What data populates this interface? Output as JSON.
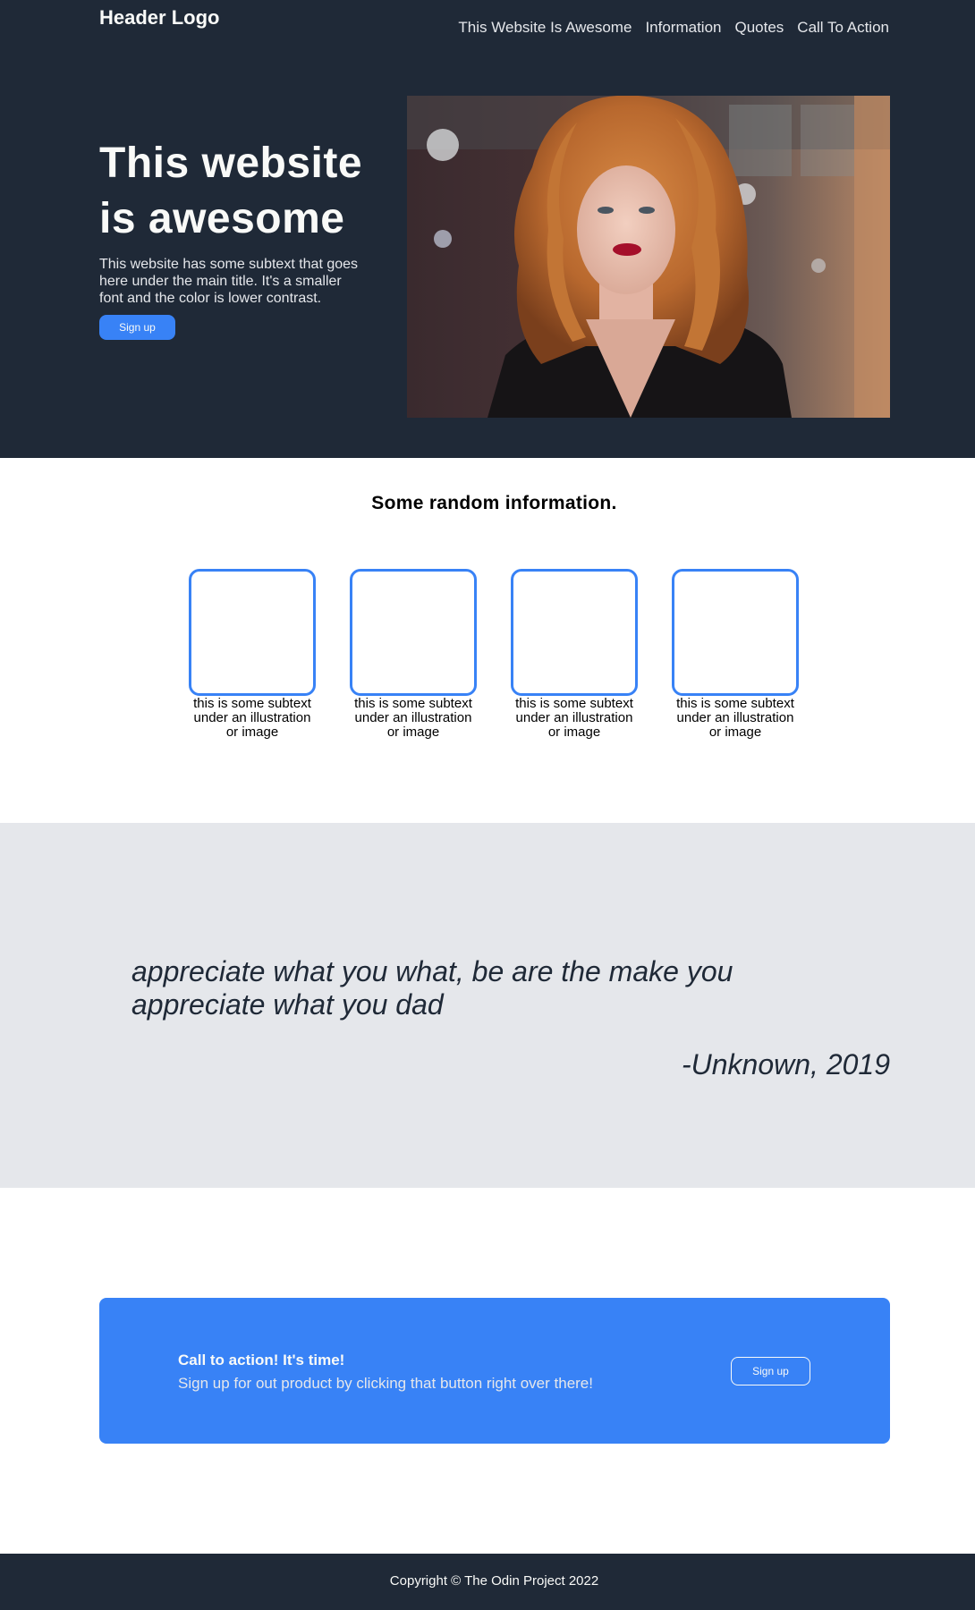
{
  "header": {
    "logo": "Header Logo",
    "nav": [
      "This Website Is Awesome",
      "Information",
      "Quotes",
      "Call To Action"
    ]
  },
  "hero": {
    "title": "This website is awesome",
    "subtext": "This website has some subtext that goes here under the main title. It's a smaller font and the color is lower contrast.",
    "button": "Sign up"
  },
  "info": {
    "title": "Some random information.",
    "cards": [
      "this is some subtext under an illustration or image",
      "this is some subtext under an illustration or image",
      "this is some subtext under an illustration or image",
      "this is some subtext under an illustration or image"
    ]
  },
  "quote": {
    "text": "appreciate what you what, be are the make you appreciate what you dad",
    "author": "-Unknown, 2019"
  },
  "cta": {
    "title": "Call to action! It's time!",
    "subtext": "Sign up for out product by clicking that button right over there!",
    "button": "Sign up"
  },
  "footer": {
    "text": "Copyright © The Odin Project 2022"
  },
  "colors": {
    "dark": "#1f2937",
    "accent": "#3882f6",
    "light_gray": "#e5e7eb",
    "off_white": "#f9faf8"
  }
}
